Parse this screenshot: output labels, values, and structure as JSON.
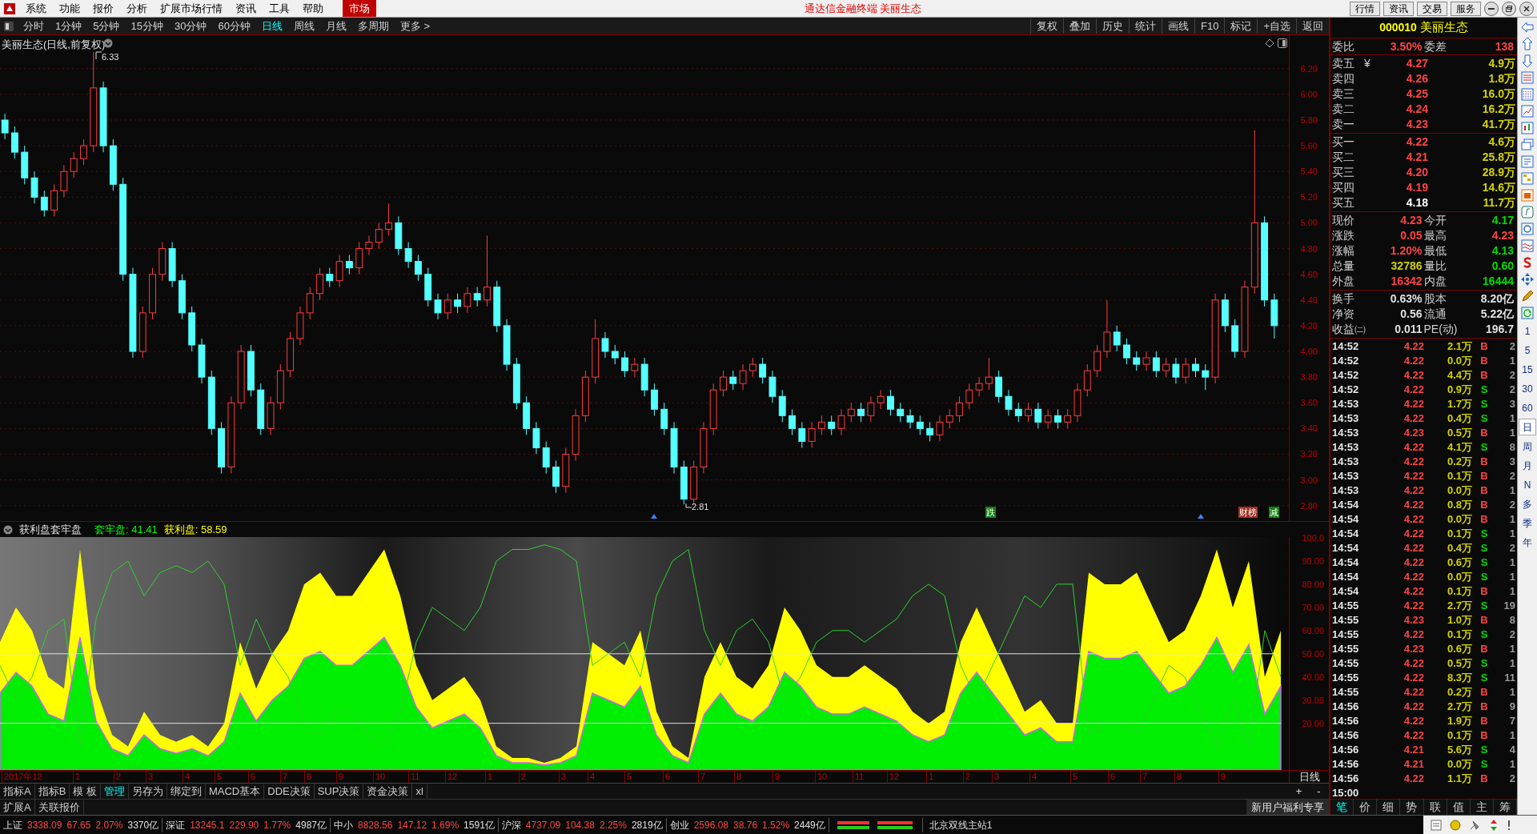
{
  "menu_bar": {
    "items": [
      {
        "label": "系统",
        "selected": false
      },
      {
        "label": "功能",
        "selected": false
      },
      {
        "label": "报价",
        "selected": false
      },
      {
        "label": "分析",
        "selected": false
      },
      {
        "label": "扩展市场行情",
        "selected": false
      },
      {
        "label": "资讯",
        "selected": false
      },
      {
        "label": "工具",
        "selected": false
      },
      {
        "label": "帮助",
        "selected": false
      },
      {
        "label": "市场",
        "selected": true
      }
    ],
    "title": "通达信金融终端 美丽生态",
    "buttons": [
      "行情",
      "资讯",
      "交易",
      "服务"
    ]
  },
  "toolbar": {
    "periods": [
      {
        "label": "分时",
        "selected": false
      },
      {
        "label": "1分钟",
        "selected": false
      },
      {
        "label": "5分钟",
        "selected": false
      },
      {
        "label": "15分钟",
        "selected": false
      },
      {
        "label": "30分钟",
        "selected": false
      },
      {
        "label": "60分钟",
        "selected": false
      },
      {
        "label": "日线",
        "selected": true
      },
      {
        "label": "周线",
        "selected": false
      },
      {
        "label": "月线",
        "selected": false
      },
      {
        "label": "多周期",
        "selected": false
      }
    ],
    "more": "更多 >",
    "tools": [
      "复权",
      "叠加",
      "历史",
      "统计",
      "画线",
      "F10",
      "标记",
      "+自选",
      "返回"
    ]
  },
  "chart": {
    "title": "美丽生态(日线,前复权)",
    "high_label": "6.33",
    "low_label": "2.81",
    "chart_data": {
      "type": "candlestick",
      "ylim": [
        2.68,
        6.46
      ],
      "yticks": [
        {
          "value": 6.2,
          "label": "6.20"
        },
        {
          "value": 6.0,
          "label": "6.00"
        },
        {
          "value": 5.8,
          "label": "5.80"
        },
        {
          "value": 5.6,
          "label": "5.60"
        },
        {
          "value": 5.4,
          "label": "5.40"
        },
        {
          "value": 5.2,
          "label": "5.20"
        },
        {
          "value": 5.0,
          "label": "5.00"
        },
        {
          "value": 4.8,
          "label": "4.80"
        },
        {
          "value": 4.6,
          "label": "4.60"
        },
        {
          "value": 4.4,
          "label": "4.40"
        },
        {
          "value": 4.2,
          "label": "4.20"
        },
        {
          "value": 4.0,
          "label": "4.00"
        },
        {
          "value": 3.8,
          "label": "3.80"
        },
        {
          "value": 3.6,
          "label": "3.60"
        },
        {
          "value": 3.4,
          "label": "3.40"
        },
        {
          "value": 3.2,
          "label": "3.20"
        },
        {
          "value": 3.0,
          "label": "3.00"
        },
        {
          "value": 2.8,
          "label": "2.80"
        }
      ],
      "grid": true,
      "ohlc": [
        [
          5.8,
          5.85,
          5.65,
          5.7
        ],
        [
          5.7,
          5.75,
          5.5,
          5.55
        ],
        [
          5.55,
          5.6,
          5.3,
          5.35
        ],
        [
          5.35,
          5.4,
          5.15,
          5.2
        ],
        [
          5.2,
          5.25,
          5.05,
          5.1
        ],
        [
          5.1,
          5.3,
          5.05,
          5.25
        ],
        [
          5.25,
          5.45,
          5.2,
          5.4
        ],
        [
          5.4,
          5.55,
          5.35,
          5.5
        ],
        [
          5.5,
          5.65,
          5.45,
          5.6
        ],
        [
          5.6,
          6.33,
          5.55,
          6.05
        ],
        [
          6.05,
          6.1,
          5.55,
          5.6
        ],
        [
          5.6,
          5.65,
          5.25,
          5.3
        ],
        [
          5.3,
          5.35,
          4.55,
          4.6
        ],
        [
          4.6,
          4.65,
          3.95,
          4.0
        ],
        [
          4.0,
          4.35,
          3.95,
          4.3
        ],
        [
          4.3,
          4.65,
          4.25,
          4.6
        ],
        [
          4.6,
          4.85,
          4.55,
          4.8
        ],
        [
          4.8,
          4.85,
          4.5,
          4.55
        ],
        [
          4.55,
          4.6,
          4.25,
          4.3
        ],
        [
          4.3,
          4.35,
          4.0,
          4.05
        ],
        [
          4.05,
          4.1,
          3.75,
          3.8
        ],
        [
          3.8,
          3.85,
          3.35,
          3.4
        ],
        [
          3.4,
          3.45,
          3.05,
          3.1
        ],
        [
          3.1,
          3.65,
          3.05,
          3.6
        ],
        [
          3.6,
          4.05,
          3.55,
          4.0
        ],
        [
          4.0,
          4.05,
          3.65,
          3.7
        ],
        [
          3.7,
          3.75,
          3.35,
          3.4
        ],
        [
          3.4,
          3.65,
          3.35,
          3.6
        ],
        [
          3.6,
          3.9,
          3.55,
          3.85
        ],
        [
          3.85,
          4.15,
          3.8,
          4.1
        ],
        [
          4.1,
          4.35,
          4.05,
          4.3
        ],
        [
          4.3,
          4.5,
          4.25,
          4.45
        ],
        [
          4.45,
          4.65,
          4.4,
          4.6
        ],
        [
          4.6,
          4.65,
          4.5,
          4.55
        ],
        [
          4.55,
          4.75,
          4.5,
          4.7
        ],
        [
          4.7,
          4.75,
          4.6,
          4.65
        ],
        [
          4.65,
          4.85,
          4.6,
          4.8
        ],
        [
          4.8,
          4.9,
          4.75,
          4.85
        ],
        [
          4.85,
          5.0,
          4.8,
          4.95
        ],
        [
          4.95,
          5.15,
          4.9,
          5.0
        ],
        [
          5.0,
          5.05,
          4.75,
          4.8
        ],
        [
          4.8,
          4.85,
          4.65,
          4.7
        ],
        [
          4.7,
          4.75,
          4.55,
          4.6
        ],
        [
          4.6,
          4.65,
          4.35,
          4.4
        ],
        [
          4.4,
          4.45,
          4.25,
          4.3
        ],
        [
          4.3,
          4.45,
          4.25,
          4.4
        ],
        [
          4.4,
          4.45,
          4.3,
          4.35
        ],
        [
          4.35,
          4.5,
          4.3,
          4.45
        ],
        [
          4.45,
          4.5,
          4.35,
          4.4
        ],
        [
          4.4,
          4.9,
          4.35,
          4.5
        ],
        [
          4.5,
          4.55,
          4.15,
          4.2
        ],
        [
          4.2,
          4.25,
          3.85,
          3.9
        ],
        [
          3.9,
          3.95,
          3.55,
          3.6
        ],
        [
          3.6,
          3.65,
          3.35,
          3.4
        ],
        [
          3.4,
          3.45,
          3.2,
          3.25
        ],
        [
          3.25,
          3.3,
          3.05,
          3.1
        ],
        [
          3.1,
          3.15,
          2.9,
          2.95
        ],
        [
          2.95,
          3.25,
          2.9,
          3.2
        ],
        [
          3.2,
          3.55,
          3.15,
          3.5
        ],
        [
          3.5,
          3.85,
          3.45,
          3.8
        ],
        [
          3.8,
          4.25,
          3.75,
          4.1
        ],
        [
          4.1,
          4.15,
          3.95,
          4.0
        ],
        [
          4.0,
          4.05,
          3.9,
          3.95
        ],
        [
          3.95,
          4.0,
          3.8,
          3.85
        ],
        [
          3.85,
          3.95,
          3.8,
          3.9
        ],
        [
          3.9,
          3.95,
          3.65,
          3.7
        ],
        [
          3.7,
          3.75,
          3.5,
          3.55
        ],
        [
          3.55,
          3.6,
          3.35,
          3.4
        ],
        [
          3.4,
          3.45,
          3.05,
          3.1
        ],
        [
          3.1,
          3.15,
          2.81,
          2.85
        ],
        [
          2.85,
          3.15,
          2.81,
          3.1
        ],
        [
          3.1,
          3.45,
          3.05,
          3.4
        ],
        [
          3.4,
          3.75,
          3.35,
          3.7
        ],
        [
          3.7,
          3.85,
          3.65,
          3.8
        ],
        [
          3.8,
          3.85,
          3.7,
          3.75
        ],
        [
          3.75,
          3.9,
          3.7,
          3.85
        ],
        [
          3.85,
          3.95,
          3.8,
          3.9
        ],
        [
          3.9,
          3.95,
          3.75,
          3.8
        ],
        [
          3.8,
          3.85,
          3.6,
          3.65
        ],
        [
          3.65,
          3.7,
          3.45,
          3.5
        ],
        [
          3.5,
          3.55,
          3.35,
          3.4
        ],
        [
          3.4,
          3.45,
          3.25,
          3.3
        ],
        [
          3.3,
          3.45,
          3.25,
          3.4
        ],
        [
          3.4,
          3.5,
          3.35,
          3.45
        ],
        [
          3.45,
          3.5,
          3.35,
          3.4
        ],
        [
          3.4,
          3.55,
          3.35,
          3.5
        ],
        [
          3.5,
          3.6,
          3.45,
          3.55
        ],
        [
          3.55,
          3.6,
          3.45,
          3.5
        ],
        [
          3.5,
          3.65,
          3.45,
          3.6
        ],
        [
          3.6,
          3.7,
          3.55,
          3.65
        ],
        [
          3.65,
          3.7,
          3.5,
          3.55
        ],
        [
          3.55,
          3.6,
          3.45,
          3.5
        ],
        [
          3.5,
          3.55,
          3.4,
          3.45
        ],
        [
          3.45,
          3.5,
          3.35,
          3.4
        ],
        [
          3.4,
          3.45,
          3.3,
          3.35
        ],
        [
          3.35,
          3.5,
          3.3,
          3.45
        ],
        [
          3.45,
          3.55,
          3.4,
          3.5
        ],
        [
          3.5,
          3.65,
          3.45,
          3.6
        ],
        [
          3.6,
          3.75,
          3.55,
          3.7
        ],
        [
          3.7,
          3.8,
          3.65,
          3.75
        ],
        [
          3.75,
          3.95,
          3.7,
          3.8
        ],
        [
          3.8,
          3.85,
          3.6,
          3.65
        ],
        [
          3.65,
          3.7,
          3.5,
          3.55
        ],
        [
          3.55,
          3.6,
          3.45,
          3.5
        ],
        [
          3.5,
          3.6,
          3.45,
          3.55
        ],
        [
          3.55,
          3.6,
          3.4,
          3.45
        ],
        [
          3.45,
          3.55,
          3.4,
          3.5
        ],
        [
          3.5,
          3.55,
          3.4,
          3.45
        ],
        [
          3.45,
          3.55,
          3.4,
          3.5
        ],
        [
          3.5,
          3.75,
          3.45,
          3.7
        ],
        [
          3.7,
          3.9,
          3.65,
          3.85
        ],
        [
          3.85,
          4.05,
          3.8,
          4.0
        ],
        [
          4.0,
          4.4,
          3.95,
          4.15
        ],
        [
          4.15,
          4.2,
          4.0,
          4.05
        ],
        [
          4.05,
          4.1,
          3.9,
          3.95
        ],
        [
          3.95,
          4.0,
          3.85,
          3.9
        ],
        [
          3.9,
          4.0,
          3.85,
          3.95
        ],
        [
          3.95,
          4.0,
          3.8,
          3.85
        ],
        [
          3.85,
          3.95,
          3.8,
          3.9
        ],
        [
          3.9,
          3.95,
          3.75,
          3.8
        ],
        [
          3.8,
          3.95,
          3.75,
          3.9
        ],
        [
          3.9,
          3.95,
          3.8,
          3.85
        ],
        [
          3.85,
          3.9,
          3.7,
          3.8
        ],
        [
          3.8,
          4.45,
          3.75,
          4.4
        ],
        [
          4.4,
          4.45,
          4.15,
          4.2
        ],
        [
          4.2,
          4.25,
          3.95,
          4.0
        ],
        [
          4.0,
          4.55,
          3.95,
          4.5
        ],
        [
          4.5,
          5.72,
          4.45,
          5.0
        ],
        [
          5.0,
          5.05,
          4.35,
          4.4
        ],
        [
          4.4,
          4.45,
          4.1,
          4.2
        ]
      ]
    },
    "markers": [
      {
        "label": "跌",
        "color": "#108010"
      },
      {
        "label": "财榜",
        "color": "#a03020"
      },
      {
        "label": "减",
        "color": "#108010"
      }
    ]
  },
  "indicator": {
    "name": "获利盘套牢盘",
    "values": [
      {
        "label": "套牢盘:",
        "value": "41.41",
        "color": "#00ff00"
      },
      {
        "label": "获利盘:",
        "value": "58.59",
        "color": "#ffff00"
      }
    ],
    "chart_data": {
      "type": "area",
      "ylim": [
        0,
        100
      ],
      "yticks": [
        {
          "value": 100,
          "label": "100.0"
        },
        {
          "value": 90,
          "label": "90.00"
        },
        {
          "value": 80,
          "label": "80.00"
        },
        {
          "value": 70,
          "label": "70.00"
        },
        {
          "value": 60,
          "label": "60.00"
        },
        {
          "value": 50,
          "label": "50.00"
        },
        {
          "value": 40,
          "label": "40.00"
        },
        {
          "value": 30,
          "label": "30.00"
        },
        {
          "value": 20,
          "label": "20.00"
        }
      ],
      "series": [
        {
          "color": "#ffff00",
          "values": [
            55,
            70,
            60,
            40,
            35,
            95,
            35,
            15,
            10,
            25,
            15,
            12,
            15,
            10,
            20,
            55,
            35,
            50,
            60,
            80,
            85,
            75,
            75,
            85,
            95,
            75,
            45,
            30,
            35,
            40,
            30,
            10,
            5,
            5,
            3,
            5,
            10,
            55,
            50,
            45,
            60,
            25,
            10,
            5,
            40,
            55,
            40,
            35,
            45,
            70,
            60,
            45,
            40,
            40,
            45,
            40,
            35,
            25,
            20,
            25,
            55,
            70,
            55,
            40,
            25,
            30,
            20,
            20,
            85,
            80,
            80,
            85,
            70,
            55,
            60,
            75,
            95,
            70,
            90,
            40,
            60
          ]
        },
        {
          "color": "#00ee00",
          "values": [
            33,
            42,
            36,
            24,
            21,
            57,
            21,
            9,
            6,
            15,
            9,
            7,
            9,
            6,
            12,
            33,
            21,
            30,
            36,
            48,
            51,
            45,
            45,
            51,
            57,
            45,
            27,
            18,
            21,
            24,
            18,
            6,
            3,
            3,
            2,
            3,
            6,
            33,
            30,
            27,
            36,
            15,
            6,
            3,
            24,
            33,
            24,
            21,
            27,
            42,
            36,
            27,
            24,
            24,
            27,
            24,
            21,
            15,
            12,
            15,
            33,
            42,
            33,
            24,
            15,
            18,
            12,
            12,
            51,
            48,
            48,
            51,
            42,
            33,
            36,
            45,
            57,
            42,
            54,
            24,
            36
          ]
        },
        {
          "type": "line",
          "color": "#30d030",
          "values": [
            45,
            30,
            40,
            60,
            65,
            10,
            65,
            85,
            90,
            75,
            85,
            88,
            85,
            90,
            80,
            45,
            65,
            50,
            40,
            20,
            15,
            25,
            25,
            15,
            10,
            25,
            55,
            70,
            65,
            60,
            70,
            90,
            95,
            95,
            97,
            95,
            90,
            45,
            50,
            55,
            40,
            75,
            90,
            95,
            60,
            45,
            60,
            65,
            55,
            30,
            40,
            55,
            60,
            60,
            55,
            60,
            65,
            75,
            80,
            75,
            45,
            30,
            45,
            60,
            75,
            70,
            80,
            80,
            15,
            20,
            20,
            15,
            30,
            45,
            40,
            25,
            10,
            30,
            10,
            60,
            40
          ]
        }
      ]
    }
  },
  "x_axis": {
    "labels": [
      "2017年12",
      "1",
      "2",
      "3",
      "4",
      "5",
      "6",
      "7",
      "8",
      "9",
      "10",
      "11",
      "12",
      "1",
      "2",
      "3",
      "4",
      "5",
      "6",
      "7",
      "8",
      "9",
      "10",
      "11",
      "12",
      "1",
      "2",
      "3",
      "4",
      "5",
      "6",
      "7",
      "8",
      "9"
    ],
    "period": "日线",
    "zoom": [
      "+",
      "-"
    ]
  },
  "bottom_tabs": {
    "tabs": [
      {
        "label": "指标A",
        "selected": false
      },
      {
        "label": "指标B",
        "selected": false
      },
      {
        "label": "模 板",
        "selected": false
      },
      {
        "label": "管理",
        "selected": true
      },
      {
        "label": "另存为",
        "selected": false
      },
      {
        "label": "绑定到",
        "selected": false
      },
      {
        "label": "MACD基本",
        "selected": false
      },
      {
        "label": "DDE决策",
        "selected": false
      },
      {
        "label": "SUP决策",
        "selected": false
      },
      {
        "label": "资金决策",
        "selected": false
      },
      {
        "label": "xl",
        "selected": false
      }
    ],
    "row2": [
      "扩展A",
      "关联报价"
    ],
    "promo": "新用户福利专享"
  },
  "quote": {
    "code": "000010",
    "name": "美丽生态",
    "ratio": [
      {
        "label": "委比",
        "value": "3.50%",
        "color": "#ff4444"
      },
      {
        "label": "委差",
        "value": "138",
        "color": "#ff4444"
      }
    ],
    "sell": [
      {
        "label": "卖五",
        "marker": "¥",
        "price": "4.27",
        "color": "#ff4444",
        "volume": "4.9万"
      },
      {
        "label": "卖四",
        "price": "4.26",
        "color": "#ff4444",
        "volume": "1.8万"
      },
      {
        "label": "卖三",
        "price": "4.25",
        "color": "#ff4444",
        "volume": "16.0万"
      },
      {
        "label": "卖二",
        "price": "4.24",
        "color": "#ff4444",
        "volume": "16.2万"
      },
      {
        "label": "卖一",
        "price": "4.23",
        "color": "#ff4444",
        "volume": "41.7万"
      }
    ],
    "buy": [
      {
        "label": "买一",
        "price": "4.22",
        "color": "#ff4444",
        "volume": "4.6万"
      },
      {
        "label": "买二",
        "price": "4.21",
        "color": "#ff4444",
        "volume": "25.8万"
      },
      {
        "label": "买三",
        "price": "4.20",
        "color": "#ff4444",
        "volume": "28.9万"
      },
      {
        "label": "买四",
        "price": "4.19",
        "color": "#ff4444",
        "volume": "14.6万"
      },
      {
        "label": "买五",
        "price": "4.18",
        "color": "#ffffff",
        "volume": "11.7万"
      }
    ],
    "stats": [
      [
        {
          "label": "现价",
          "value": "4.23",
          "color": "#ff4444"
        },
        {
          "label": "今开",
          "value": "4.17",
          "color": "#00dd00"
        }
      ],
      [
        {
          "label": "涨跌",
          "value": "0.05",
          "color": "#ff4444"
        },
        {
          "label": "最高",
          "value": "4.23",
          "color": "#ff4444"
        }
      ],
      [
        {
          "label": "涨幅",
          "value": "1.20%",
          "color": "#ff4444"
        },
        {
          "label": "最低",
          "value": "4.13",
          "color": "#00dd00"
        }
      ],
      [
        {
          "label": "总量",
          "value": "32786",
          "color": "#d0d000"
        },
        {
          "label": "量比",
          "value": "0.60",
          "color": "#00dd00"
        }
      ],
      [
        {
          "label": "外盘",
          "value": "16342",
          "color": "#ff4444"
        },
        {
          "label": "内盘",
          "value": "16444",
          "color": "#00dd00"
        }
      ]
    ],
    "finance": [
      [
        {
          "label": "换手",
          "value": "0.63%"
        },
        {
          "label": "股本",
          "value": "8.20亿"
        }
      ],
      [
        {
          "label": "净资",
          "value": "0.56"
        },
        {
          "label": "流通",
          "value": "5.22亿"
        }
      ],
      [
        {
          "label": "收益㈡",
          "value": "0.011"
        },
        {
          "label": "PE(动)",
          "value": "196.7"
        }
      ]
    ]
  },
  "trades": [
    {
      "time": "14:52",
      "price": "4.22",
      "volume": "2.1万",
      "side": "B",
      "kind": "buy",
      "count": "2"
    },
    {
      "time": "14:52",
      "price": "4.22",
      "volume": "0.0万",
      "side": "B",
      "kind": "buy",
      "count": "1"
    },
    {
      "time": "14:52",
      "price": "4.22",
      "volume": "4.4万",
      "side": "B",
      "kind": "buy",
      "count": "2"
    },
    {
      "time": "14:52",
      "price": "4.22",
      "volume": "0.9万",
      "side": "S",
      "kind": "sell",
      "count": "2"
    },
    {
      "time": "14:53",
      "price": "4.22",
      "volume": "1.7万",
      "side": "S",
      "kind": "sell",
      "count": "3"
    },
    {
      "time": "14:53",
      "price": "4.22",
      "volume": "0.4万",
      "side": "S",
      "kind": "sell",
      "count": "1"
    },
    {
      "time": "14:53",
      "price": "4.23",
      "volume": "0.5万",
      "side": "B",
      "kind": "buy",
      "count": "1"
    },
    {
      "time": "14:53",
      "price": "4.22",
      "volume": "4.1万",
      "side": "S",
      "kind": "sell",
      "count": "8"
    },
    {
      "time": "14:53",
      "price": "4.22",
      "volume": "0.2万",
      "side": "B",
      "kind": "buy",
      "count": "3"
    },
    {
      "time": "14:53",
      "price": "4.22",
      "volume": "0.1万",
      "side": "B",
      "kind": "buy",
      "count": "2"
    },
    {
      "time": "14:53",
      "price": "4.22",
      "volume": "0.0万",
      "side": "B",
      "kind": "buy",
      "count": "1"
    },
    {
      "time": "14:54",
      "price": "4.22",
      "volume": "0.8万",
      "side": "B",
      "kind": "buy",
      "count": "2"
    },
    {
      "time": "14:54",
      "price": "4.22",
      "volume": "0.0万",
      "side": "B",
      "kind": "buy",
      "count": "1"
    },
    {
      "time": "14:54",
      "price": "4.22",
      "volume": "0.1万",
      "side": "S",
      "kind": "sell",
      "count": "1"
    },
    {
      "time": "14:54",
      "price": "4.22",
      "volume": "0.4万",
      "side": "S",
      "kind": "sell",
      "count": "2"
    },
    {
      "time": "14:54",
      "price": "4.22",
      "volume": "0.6万",
      "side": "S",
      "kind": "sell",
      "count": "1"
    },
    {
      "time": "14:54",
      "price": "4.22",
      "volume": "0.0万",
      "side": "S",
      "kind": "sell",
      "count": "1"
    },
    {
      "time": "14:54",
      "price": "4.22",
      "volume": "0.1万",
      "side": "B",
      "kind": "buy",
      "count": "1"
    },
    {
      "time": "14:55",
      "price": "4.22",
      "volume": "2.7万",
      "side": "S",
      "kind": "sell",
      "count": "19"
    },
    {
      "time": "14:55",
      "price": "4.23",
      "volume": "1.0万",
      "side": "B",
      "kind": "buy",
      "count": "8"
    },
    {
      "time": "14:55",
      "price": "4.22",
      "volume": "0.1万",
      "side": "S",
      "kind": "sell",
      "count": "2"
    },
    {
      "time": "14:55",
      "price": "4.23",
      "volume": "0.6万",
      "side": "B",
      "kind": "buy",
      "count": "1"
    },
    {
      "time": "14:55",
      "price": "4.22",
      "volume": "0.5万",
      "side": "S",
      "kind": "sell",
      "count": "1"
    },
    {
      "time": "14:55",
      "price": "4.22",
      "volume": "8.3万",
      "side": "S",
      "kind": "sell",
      "count": "11"
    },
    {
      "time": "14:55",
      "price": "4.22",
      "volume": "0.2万",
      "side": "B",
      "kind": "buy",
      "count": "1"
    },
    {
      "time": "14:56",
      "price": "4.22",
      "volume": "2.7万",
      "side": "B",
      "kind": "buy",
      "count": "9"
    },
    {
      "time": "14:56",
      "price": "4.22",
      "volume": "1.9万",
      "side": "B",
      "kind": "buy",
      "count": "7"
    },
    {
      "time": "14:56",
      "price": "4.22",
      "volume": "0.1万",
      "side": "B",
      "kind": "buy",
      "count": "1"
    },
    {
      "time": "14:56",
      "price": "4.21",
      "volume": "5.6万",
      "side": "S",
      "kind": "sell",
      "count": "4"
    },
    {
      "time": "14:56",
      "price": "4.21",
      "volume": "0.0万",
      "side": "S",
      "kind": "sell",
      "count": "1"
    },
    {
      "time": "14:56",
      "price": "4.22",
      "volume": "1.1万",
      "side": "B",
      "kind": "buy",
      "count": "2"
    },
    {
      "time": "15:00"
    }
  ],
  "panel_tabs": [
    {
      "label": "笔",
      "selected": true
    },
    {
      "label": "价",
      "selected": false
    },
    {
      "label": "细",
      "selected": false
    },
    {
      "label": "势",
      "selected": false
    },
    {
      "label": "联",
      "selected": false
    },
    {
      "label": "值",
      "selected": false
    },
    {
      "label": "主",
      "selected": false
    },
    {
      "label": "筹",
      "selected": false
    }
  ],
  "side_periods": [
    {
      "label": "1",
      "selected": false
    },
    {
      "label": "5",
      "selected": false
    },
    {
      "label": "15",
      "selected": false
    },
    {
      "label": "30",
      "selected": false
    },
    {
      "label": "60",
      "selected": false
    },
    {
      "label": "日",
      "selected": true
    },
    {
      "label": "周",
      "selected": false
    },
    {
      "label": "月",
      "selected": false
    },
    {
      "label": "N",
      "selected": false
    },
    {
      "label": "多",
      "selected": false
    },
    {
      "label": "季",
      "selected": false
    },
    {
      "label": "年",
      "selected": false
    }
  ],
  "status_bar": {
    "indices": [
      {
        "name": "上证",
        "price": "3338.09",
        "change": "67.65",
        "percent": "2.07%",
        "amount": "3370亿"
      },
      {
        "name": "深证",
        "price": "13245.1",
        "change": "229.90",
        "percent": "1.77%",
        "amount": "4987亿"
      },
      {
        "name": "中小",
        "price": "8828.56",
        "change": "147.12",
        "percent": "1.69%",
        "amount": "1591亿"
      },
      {
        "name": "沪深",
        "price": "4737.09",
        "change": "104.38",
        "percent": "2.25%",
        "amount": "2819亿"
      },
      {
        "name": "创业",
        "price": "2596.08",
        "change": "38.76",
        "percent": "1.52%",
        "amount": "2449亿"
      }
    ],
    "server": "北京双线主站1"
  }
}
